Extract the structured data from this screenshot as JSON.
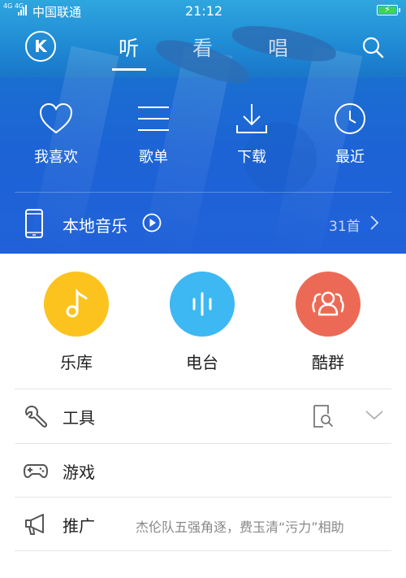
{
  "status_bar": {
    "network": "4G 4G",
    "carrier": "中国联通",
    "time": "21:12"
  },
  "header": {
    "logo": "K",
    "tabs": [
      {
        "label": "听",
        "active": true
      },
      {
        "label": "看",
        "active": false
      },
      {
        "label": "唱",
        "active": false
      }
    ],
    "search_icon": "search-icon"
  },
  "quick_actions": [
    {
      "label": "我喜欢",
      "icon": "heart-icon"
    },
    {
      "label": "歌单",
      "icon": "list-icon"
    },
    {
      "label": "下载",
      "icon": "download-icon"
    },
    {
      "label": "最近",
      "icon": "clock-icon"
    }
  ],
  "local_music": {
    "label": "本地音乐",
    "count": "31首",
    "icon": "phone-icon"
  },
  "categories": [
    {
      "label": "乐库",
      "icon": "music-note-icon",
      "color": "#fcc31e"
    },
    {
      "label": "电台",
      "icon": "soundwave-icon",
      "color": "#3db8f2"
    },
    {
      "label": "酷群",
      "icon": "group-icon",
      "color": "#ec6a55"
    }
  ],
  "menu": [
    {
      "label": "工具",
      "icon": "wrench-icon",
      "note": ""
    },
    {
      "label": "游戏",
      "icon": "gamepad-icon",
      "note": ""
    },
    {
      "label": "推广",
      "icon": "megaphone-icon",
      "note": "杰伦队五强角逐，费玉清“污力”相助"
    }
  ],
  "colors": {
    "header_blue": "#1d6fd3",
    "battery_green": "#3fd35a",
    "text_dark": "#222222",
    "text_muted": "#888888"
  }
}
